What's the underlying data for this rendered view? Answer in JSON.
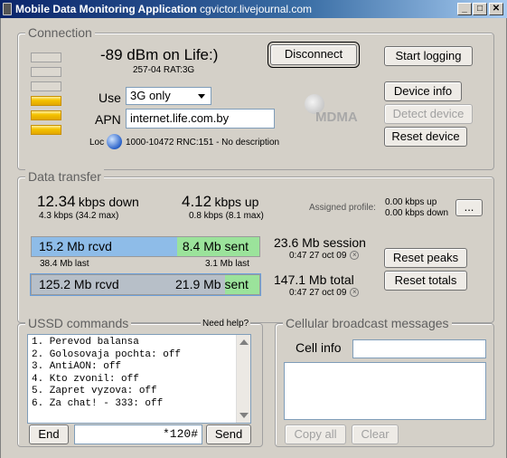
{
  "window": {
    "title": "Mobile Data Monitoring Application",
    "subtitle": "cgvictor.livejournal.com",
    "minimize": "_",
    "maximize": "□",
    "close": "✕"
  },
  "connection": {
    "group_label": "Connection",
    "signal_text": "-89 dBm on Life:)",
    "cell_text": "257-04 RAT:3G",
    "signal_bars_total": 6,
    "signal_bars_lit": 3,
    "use_label": "Use",
    "use_value": "3G only",
    "apn_label": "APN",
    "apn_value": "internet.life.com.by",
    "loc_label": "Loc",
    "loc_value": "1000-10472 RNC:151 - No description",
    "logo_text": "MDMA",
    "disconnect": "Disconnect",
    "start_logging": "Start logging",
    "device_info": "Device info",
    "detect_device": "Detect device",
    "reset_device": "Reset device"
  },
  "transfer": {
    "group_label": "Data transfer",
    "down_value": "12.34",
    "down_unit": "kbps down",
    "down_sub": "4.3 kbps (34.2 max)",
    "up_value": "4.12",
    "up_unit": "kbps up",
    "up_sub": "0.8 kbps (8.1 max)",
    "assigned_label": "Assigned profile:",
    "assigned_up": "0.00 kbps up",
    "assigned_down": "0.00 kbps down",
    "profile_button": "...",
    "session_rcvd": "15.2 Mb rcvd",
    "session_sent": "8.4 Mb sent",
    "session_rcvd_fraction": 0.64,
    "rcvd_last": "38.4 Mb last",
    "sent_last": "3.1 Mb last",
    "session_total": "23.6 Mb session",
    "session_time": "0:47 27 oct 09",
    "total_rcvd": "125.2 Mb rcvd",
    "total_sent": "21.9 Mb sent",
    "total_rcvd_fraction": 0.85,
    "grand_total": "147.1 Mb total",
    "total_time": "0:47 27 oct 09",
    "reset_peaks": "Reset peaks",
    "reset_totals": "Reset totals",
    "colors": {
      "rcvd": "#8ebce8",
      "sent": "#9be39b",
      "total_rcvd": "#b7bfc8"
    }
  },
  "ussd": {
    "group_label": "USSD commands",
    "help": "Need help?",
    "lines": [
      "1. Perevod balansa",
      "2. Golosovaja pochta: off",
      "3. AntiAON: off",
      "4. Kto zvonil: off",
      "5. Zapret vyzova: off",
      "6. Za chat! - 333: off"
    ],
    "end_button": "End",
    "command_value": "*120#",
    "send_button": "Send"
  },
  "broadcast": {
    "group_label": "Cellular broadcast messages",
    "cell_info_label": "Cell info",
    "cell_info_value": "",
    "copy_all": "Copy all",
    "clear": "Clear"
  }
}
